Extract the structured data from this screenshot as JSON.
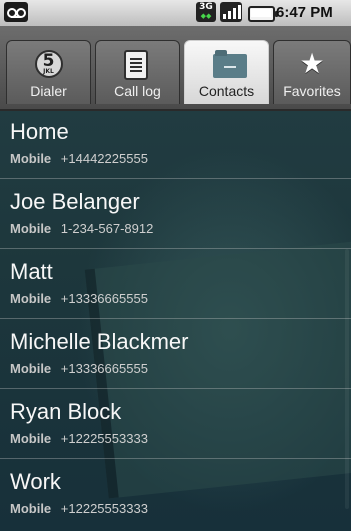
{
  "status_bar": {
    "network_label": "3G",
    "time": "6:47 PM"
  },
  "tabs": [
    {
      "label": "Dialer",
      "badge_number": "5",
      "badge_letters": "JKL"
    },
    {
      "label": "Call log"
    },
    {
      "label": "Contacts"
    },
    {
      "label": "Favorites"
    }
  ],
  "contacts": [
    {
      "name": "Home",
      "type": "Mobile",
      "number": "+14442225555"
    },
    {
      "name": "Joe Belanger",
      "type": "Mobile",
      "number": "1-234-567-8912"
    },
    {
      "name": "Matt",
      "type": "Mobile",
      "number": "+13336665555"
    },
    {
      "name": "Michelle Blackmer",
      "type": "Mobile",
      "number": "+13336665555"
    },
    {
      "name": "Ryan Block",
      "type": "Mobile",
      "number": "+12225553333"
    },
    {
      "name": "Work",
      "type": "Mobile",
      "number": "+12225553333"
    }
  ],
  "colors": {
    "list_background": "#1b3539",
    "accent": "#5a7d88"
  }
}
